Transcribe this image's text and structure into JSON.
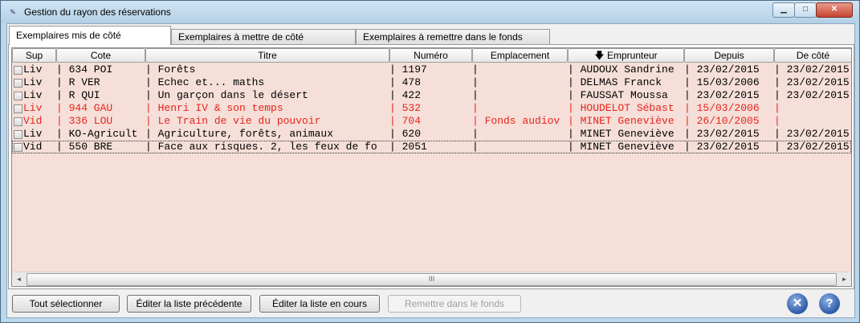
{
  "window": {
    "title": "Gestion du rayon des réservations",
    "minimize_glyph": "▁",
    "maximize_glyph": "□",
    "close_glyph": "✕"
  },
  "tabs": [
    {
      "label": "Exemplaires mis de côté",
      "active": true
    },
    {
      "label": "Exemplaires à mettre de côté",
      "active": false
    },
    {
      "label": "Exemplaires à remettre dans le fonds",
      "active": false
    }
  ],
  "columns": [
    "Sup",
    "Cote",
    "Titre",
    "Numéro",
    "Emplacement",
    "Emprunteur",
    "Depuis",
    "De côté"
  ],
  "sort_indicator": "🡇",
  "rows": [
    {
      "sup": "Liv",
      "cote": "| 634 POI",
      "titre": "| Forêts",
      "numero": "| 1197",
      "emplacement": "|",
      "emprunteur": "| AUDOUX Sandrine",
      "depuis": "| 23/02/2015",
      "decote": "| 23/02/2015",
      "red": false,
      "selected": false
    },
    {
      "sup": "Liv",
      "cote": "| R VER",
      "titre": "| Echec et... maths",
      "numero": "| 478",
      "emplacement": "|",
      "emprunteur": "| DELMAS Franck",
      "depuis": "| 15/03/2006",
      "decote": "| 23/02/2015",
      "red": false,
      "selected": false
    },
    {
      "sup": "Liv",
      "cote": "| R QUI",
      "titre": "| Un garçon dans le désert",
      "numero": "| 422",
      "emplacement": "|",
      "emprunteur": "| FAUSSAT Moussa",
      "depuis": "| 23/02/2015",
      "decote": "| 23/02/2015",
      "red": false,
      "selected": false
    },
    {
      "sup": "Liv",
      "cote": "| 944 GAU",
      "titre": "| Henri IV & son temps",
      "numero": "| 532",
      "emplacement": "|",
      "emprunteur": "| HOUDELOT Sébast",
      "depuis": "| 15/03/2006",
      "decote": "|",
      "red": true,
      "selected": false
    },
    {
      "sup": "Vid",
      "cote": "| 336 LOU",
      "titre": "| Le Train de vie du pouvoir",
      "numero": "| 704",
      "emplacement": "| Fonds audiov",
      "emprunteur": "| MINET Geneviève",
      "depuis": "| 26/10/2005",
      "decote": "|",
      "red": true,
      "selected": false
    },
    {
      "sup": "Liv",
      "cote": "| KO-Agricult",
      "titre": "| Agriculture, forêts, animaux",
      "numero": "| 620",
      "emplacement": "|",
      "emprunteur": "| MINET Geneviève",
      "depuis": "| 23/02/2015",
      "decote": "| 23/02/2015",
      "red": false,
      "selected": false
    },
    {
      "sup": "Vid",
      "cote": "| 550 BRE",
      "titre": "| Face aux risques. 2, les feux de fo",
      "numero": "| 2051",
      "emplacement": "|",
      "emprunteur": "| MINET Geneviève",
      "depuis": "| 23/02/2015",
      "decote": "| 23/02/2015",
      "red": false,
      "selected": true
    }
  ],
  "scrollbar": {
    "left": "◄",
    "right": "►",
    "thumb": "III"
  },
  "buttons": {
    "select_all": "Tout sélectionner",
    "edit_previous": "Éditer la liste précédente",
    "edit_current": "Éditer la liste en cours",
    "return_to_stock": "Remettre dans le fonds"
  },
  "icons": {
    "close": "✕",
    "help": "?"
  },
  "colors": {
    "row_bg": "#f5dfd8",
    "highlight": "#e8241e"
  }
}
